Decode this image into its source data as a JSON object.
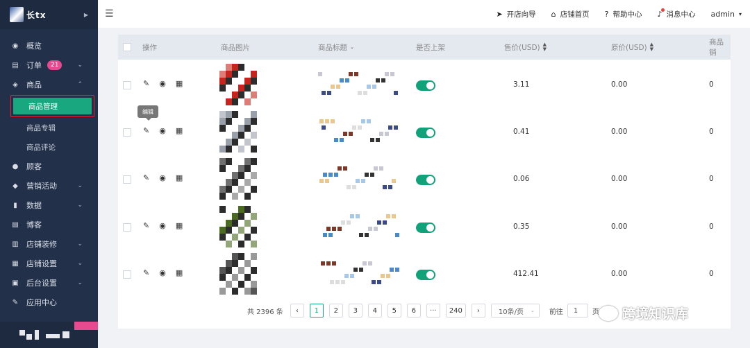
{
  "logo": {
    "text": "长tx"
  },
  "sidebar": {
    "items": [
      {
        "label": "概览",
        "icon": "dashboard-icon",
        "glyph": "◉"
      },
      {
        "label": "订单",
        "icon": "clipboard-icon",
        "glyph": "▤",
        "badge": "21",
        "chevron": "⌄"
      },
      {
        "label": "商品",
        "icon": "box-icon",
        "glyph": "◈",
        "chevron": "⌃"
      }
    ],
    "goods_sub": {
      "active": "商品管理",
      "topics": "商品专辑",
      "reviews": "商品评论"
    },
    "items2": [
      {
        "label": "顾客",
        "icon": "user-icon",
        "glyph": "●"
      },
      {
        "label": "营销活动",
        "icon": "tag-icon",
        "glyph": "◆",
        "chevron": "⌄"
      },
      {
        "label": "数据",
        "icon": "bar-chart-icon",
        "glyph": "▮",
        "chevron": "⌄"
      },
      {
        "label": "博客",
        "icon": "document-icon",
        "glyph": "▤"
      },
      {
        "label": "店铺装修",
        "icon": "paint-roller-icon",
        "glyph": "▥",
        "chevron": "⌄"
      },
      {
        "label": "店铺设置",
        "icon": "calendar-icon",
        "glyph": "▦",
        "chevron": "⌄"
      },
      {
        "label": "后台设置",
        "icon": "monitor-icon",
        "glyph": "▣",
        "chevron": "⌄"
      },
      {
        "label": "应用中心",
        "icon": "wrench-icon",
        "glyph": "✎"
      }
    ]
  },
  "topbar": {
    "menu_icon": "☰",
    "items": [
      {
        "label": "开店向导",
        "icon": "send-icon",
        "glyph": "➤"
      },
      {
        "label": "店铺首页",
        "icon": "home-icon",
        "glyph": "⌂"
      },
      {
        "label": "帮助中心",
        "icon": "question-icon",
        "glyph": "?"
      },
      {
        "label": "消息中心",
        "icon": "bell-icon",
        "glyph": "♪"
      }
    ],
    "user": "admin",
    "user_caret": "▾"
  },
  "table": {
    "headers": {
      "actions": "操作",
      "image": "商品图片",
      "title": "商品标题",
      "title_sort": "⌄",
      "on_shelf": "是否上架",
      "price": "售价(USD)",
      "orig_price": "原价(USD)",
      "sales": "商品销"
    },
    "action_icons": {
      "edit": "✎",
      "view": "◉",
      "delete": "▦"
    },
    "tooltip": "编辑",
    "rows": [
      {
        "price": "3.11",
        "orig_price": "0.00",
        "sales": "0",
        "on_shelf": true
      },
      {
        "price": "0.41",
        "orig_price": "0.00",
        "sales": "0",
        "on_shelf": true
      },
      {
        "price": "0.06",
        "orig_price": "0.00",
        "sales": "0",
        "on_shelf": true
      },
      {
        "price": "0.35",
        "orig_price": "0.00",
        "sales": "0",
        "on_shelf": true
      },
      {
        "price": "412.41",
        "orig_price": "0.00",
        "sales": "0",
        "on_shelf": true
      }
    ],
    "title_fragments": [
      "",
      "下厂",
      "生",
      "区域",
      "公权",
      "sidic 动长",
      "沃...",
      ""
    ],
    "thumb_colors": [
      "#c8241e",
      "#9aa0aa",
      "#707070",
      "#4a6a20",
      "#555555"
    ]
  },
  "pagination": {
    "total": "共 2396 条",
    "prev": "‹",
    "pages": [
      "1",
      "2",
      "3",
      "4",
      "5",
      "6",
      "···",
      "240"
    ],
    "next": "›",
    "page_size": "10条/页",
    "goto": "前往",
    "goto_value": "1",
    "goto_suffix": "页"
  },
  "watermark": "跨境知识库",
  "colors": {
    "accent": "#19a77f",
    "sidebar": "#22304a",
    "badge": "#e84a8f",
    "highlight": "#e0253a"
  }
}
